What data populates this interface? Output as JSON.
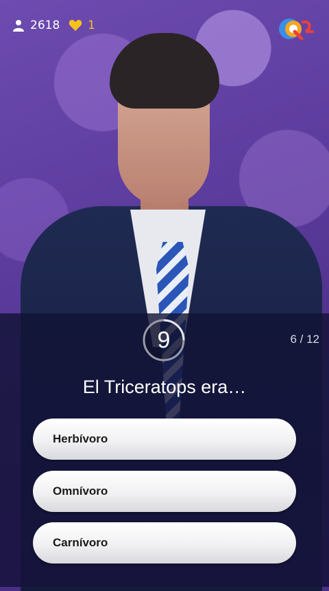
{
  "header": {
    "viewer_count": "2618",
    "lives_count": "1",
    "icons": {
      "viewers": "person-icon",
      "lives": "heart-icon",
      "logo": "q-logo-icon"
    }
  },
  "question": {
    "timer_value": "9",
    "progress": "6 / 12",
    "text": "El Triceratops era…",
    "answers": [
      {
        "label": "Herbívoro"
      },
      {
        "label": "Omnívoro"
      },
      {
        "label": "Carnívoro"
      }
    ]
  },
  "colors": {
    "accent_purple": "#5b3b9c",
    "heart_yellow": "#f4c21d",
    "logo_blue": "#3a8ee6",
    "logo_orange": "#f5a623",
    "logo_red": "#e8413c"
  }
}
